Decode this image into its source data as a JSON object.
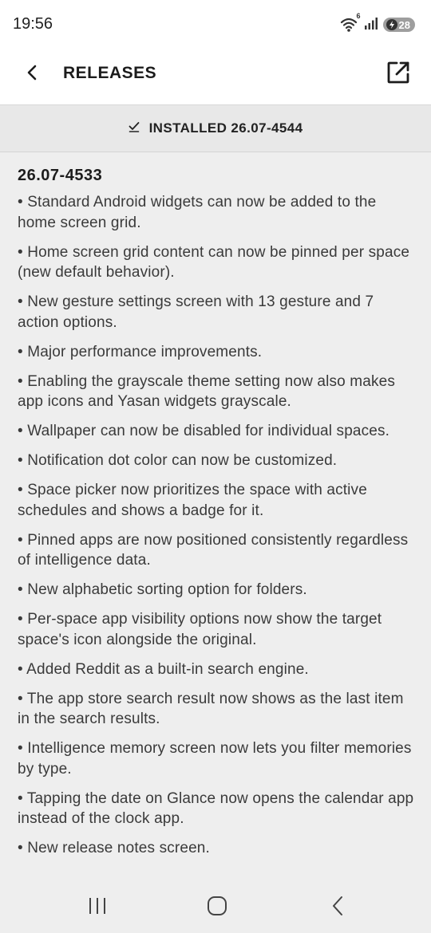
{
  "status_bar": {
    "time": "19:56",
    "wifi_badge": "6",
    "battery": "28"
  },
  "app_bar": {
    "title": "RELEASES",
    "back_icon": "chevron-left-icon",
    "open_icon": "open-external-icon"
  },
  "installed": {
    "label": "INSTALLED 26.07-4544",
    "icon": "check-icon"
  },
  "release": {
    "version": "26.07-4533",
    "notes": [
      "• Standard Android widgets can now be added to the home screen grid.",
      "• Home screen grid content can now be pinned per space (new default behavior).",
      "• New gesture settings screen with 13 gesture and 7 action options.",
      "• Major performance improvements.",
      "• Enabling the grayscale theme setting now also makes app icons and Yasan widgets grayscale.",
      "• Wallpaper can now be disabled for individual spaces.",
      "• Notification dot color can now be customized.",
      "• Space picker now prioritizes the space with active schedules and shows a badge for it.",
      "• Pinned apps are now positioned consistently regardless of intelligence data.",
      "• New alphabetic sorting option for folders.",
      "• Per-space app visibility options now show the target space's icon alongside the original.",
      "• Added Reddit as a built-in search engine.",
      "• The app store search result now shows as the last item in the search results.",
      "• Intelligence memory screen now lets you filter memories by type.",
      "• Tapping the date on Glance now opens the calendar app instead of the clock app.",
      "• New release notes screen."
    ]
  },
  "nav_bar": {
    "recents_icon": "recents-icon",
    "home_icon": "home-icon",
    "back_icon": "back-icon"
  },
  "colors": {
    "background": "#eeeeee",
    "app_bar": "#ffffff",
    "installed_bar": "#e8e8e8",
    "text": "#3a3a3a"
  }
}
